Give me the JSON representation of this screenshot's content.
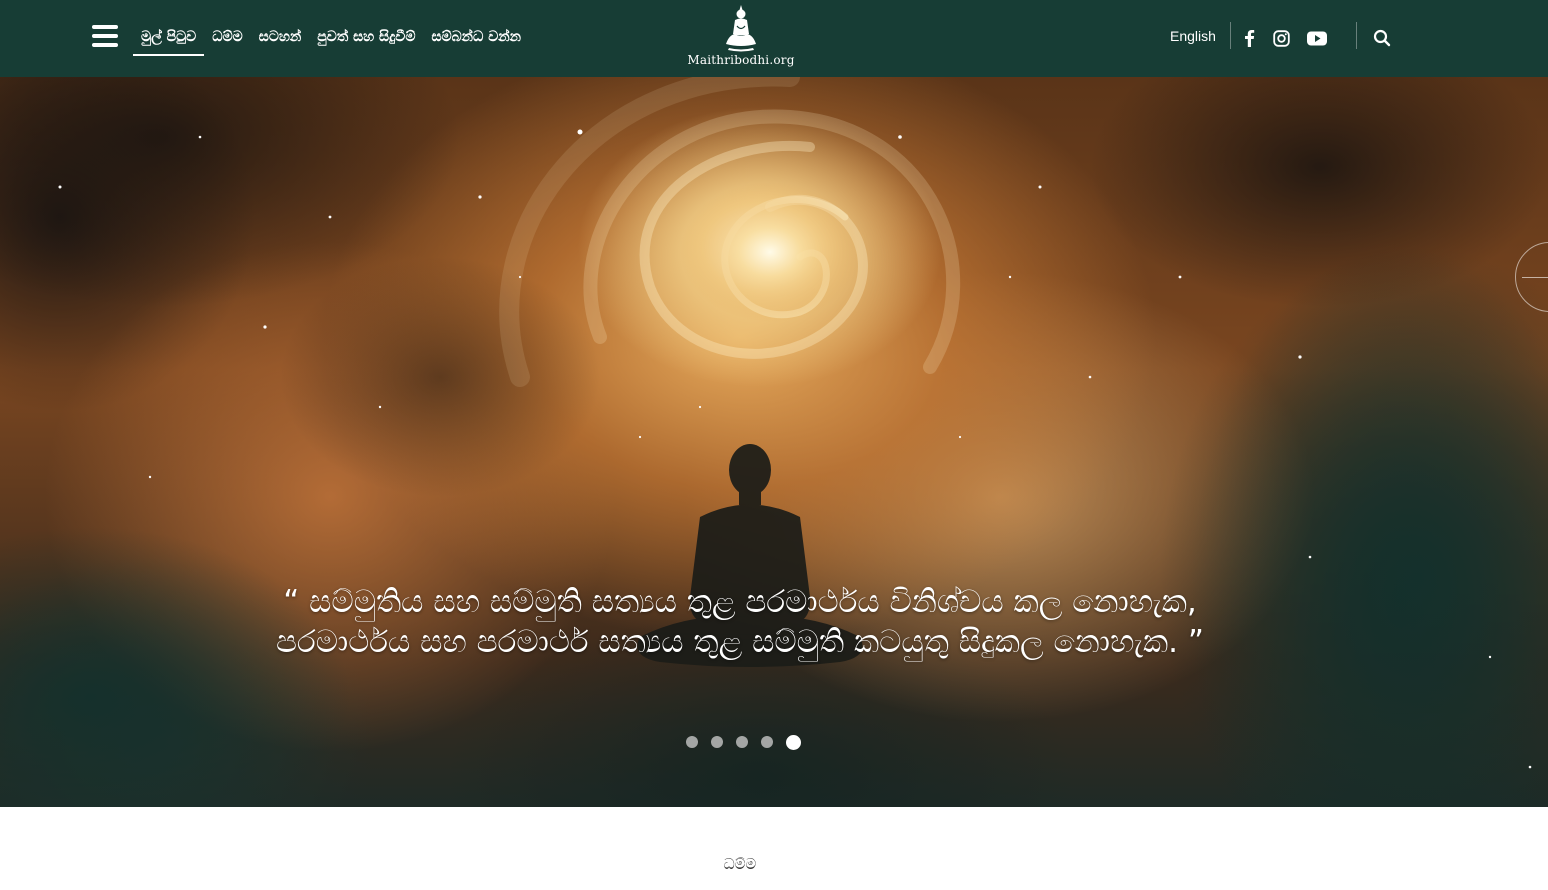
{
  "header": {
    "nav": [
      {
        "label": "මුල් පිටුව",
        "active": true
      },
      {
        "label": "ධම්ම",
        "active": false
      },
      {
        "label": "සටහන්",
        "active": false
      },
      {
        "label": "පුවත් සහ සිදුවීම්",
        "active": false
      },
      {
        "label": "සම්බන්ධ වන්න",
        "active": false
      }
    ],
    "logo_text": "Maithribodhi.org",
    "language_label": "English",
    "social_icons": [
      "facebook-icon",
      "instagram-icon",
      "youtube-icon"
    ],
    "search_icon": "search-icon",
    "menu_icon": "hamburger-menu-icon"
  },
  "hero": {
    "quote_line1": "“ සම්මුතිය සහ සම්මුති සත්‍යය තුළ පරමාර්ථය විනිශ්චය කල නොහැක,",
    "quote_line2": "පරමාර්ථය සහ පරමාර්ථ සත්‍යය තුළ සම්මුති කටයුතු සිදුකල නොහැක. ”",
    "slide_count": 5,
    "active_slide": 5
  },
  "section": {
    "label": "ධම්ම"
  },
  "colors": {
    "header_bg": "#173d35",
    "text_light": "#ffffff"
  }
}
